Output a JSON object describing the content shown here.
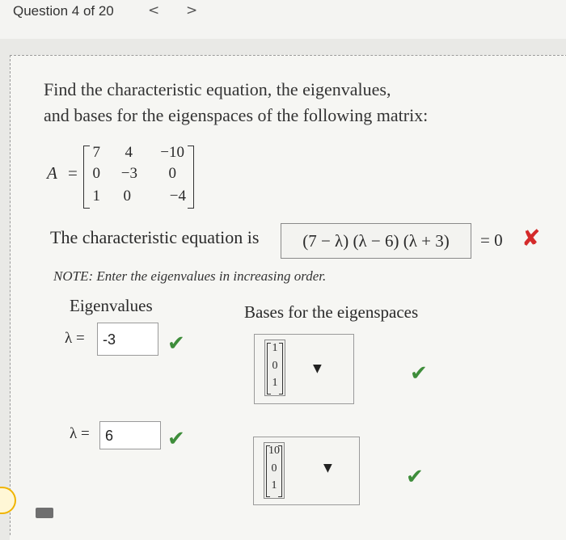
{
  "header": {
    "question_label": "Question 4 of 20",
    "prev_glyph": "<",
    "next_glyph": ">"
  },
  "prompt": {
    "line1": "Find the characteristic equation, the eigenvalues,",
    "line2": "and bases for the eigenspaces of the following matrix:"
  },
  "matrix": {
    "label": "A",
    "equals": "=",
    "rows": [
      [
        "7",
        "4",
        "−10"
      ],
      [
        "0",
        "−3",
        "0"
      ],
      [
        "1",
        "0",
        "−4"
      ]
    ]
  },
  "characteristic": {
    "prefix": "The characteristic equation is",
    "value": "(7 − λ) (λ − 6) (λ + 3)",
    "suffix": "= 0",
    "status_icon": "x-mark",
    "status_color": "#d42a2a"
  },
  "note": "NOTE: Enter the eigenvalues in increasing order.",
  "columns": {
    "eigenvalues": "Eigenvalues",
    "bases": "Bases for the eigenspaces"
  },
  "eigen_rows": [
    {
      "lambda_label": "λ =",
      "value": "-3",
      "basis": [
        "1",
        "0",
        "1"
      ],
      "status_icon": "check-mark"
    },
    {
      "lambda_label": "λ =",
      "value": "6",
      "basis": [
        "10",
        "0",
        "1"
      ],
      "status_icon": "check-mark"
    }
  ],
  "check_color": "#3e8d3a",
  "dropdown_glyph": "▼",
  "status_glyphs": {
    "x": "✘",
    "check": "✔"
  }
}
